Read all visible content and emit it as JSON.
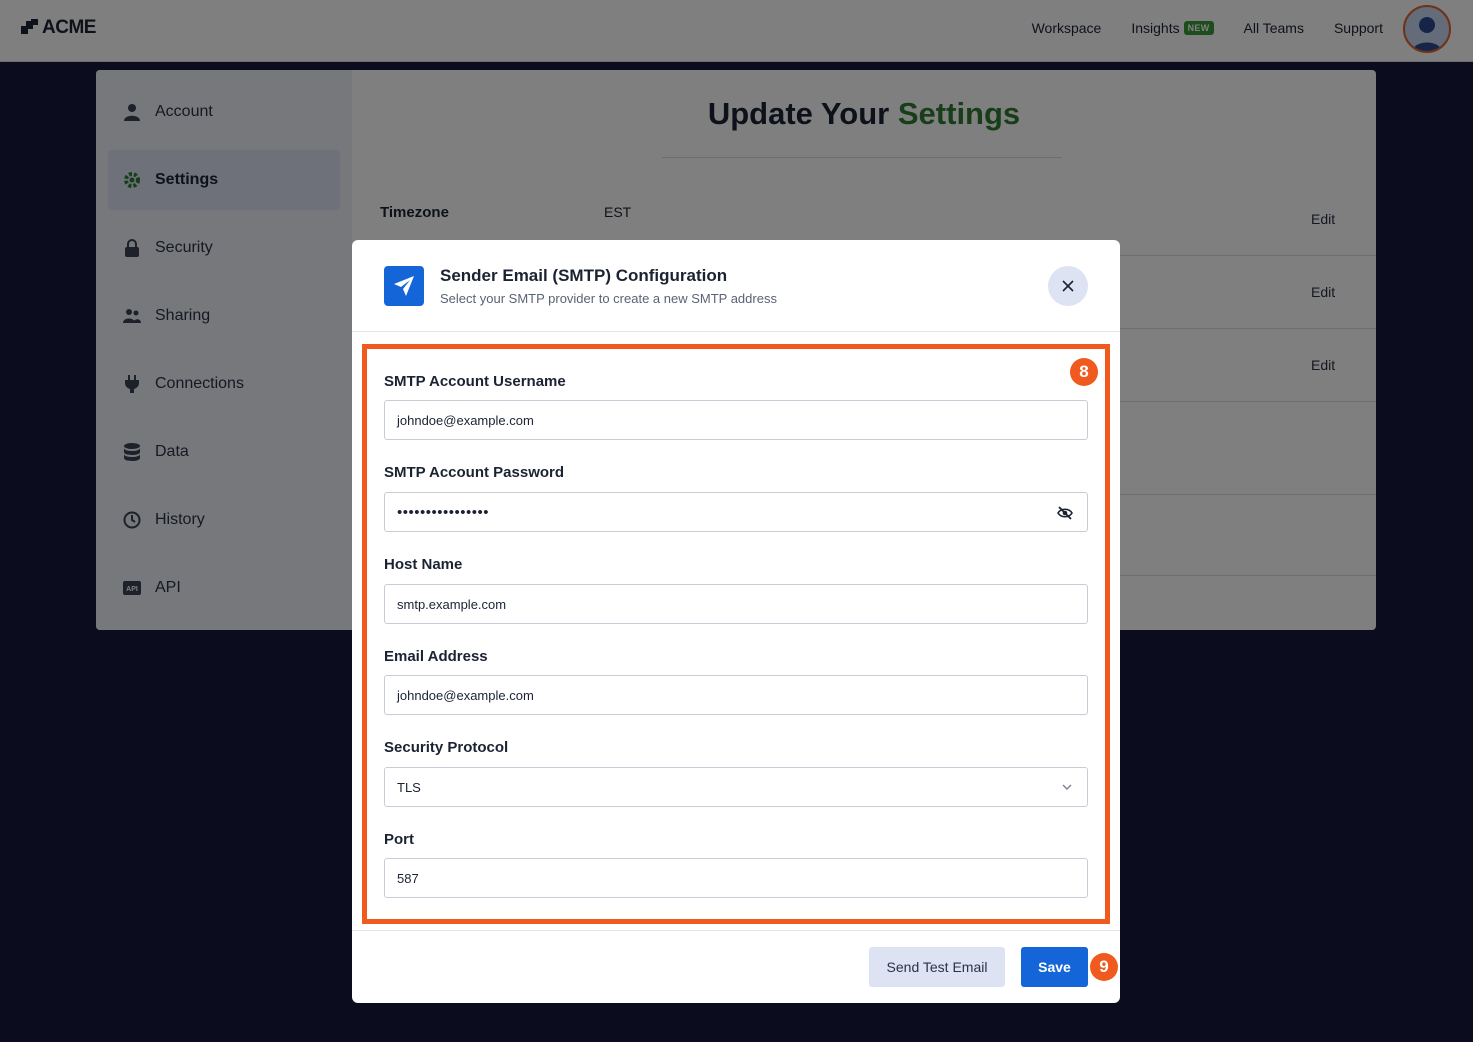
{
  "app": {
    "logo_text": "ACME"
  },
  "nav": {
    "items": [
      {
        "label": "Workspace"
      },
      {
        "label": "Insights",
        "badge": "NEW"
      },
      {
        "label": "All Teams"
      },
      {
        "label": "Support"
      }
    ]
  },
  "sidebar": {
    "items": [
      {
        "label": "Account",
        "icon": "user-icon"
      },
      {
        "label": "Settings",
        "icon": "gear-icon",
        "active": true
      },
      {
        "label": "Security",
        "icon": "lock-icon"
      },
      {
        "label": "Sharing",
        "icon": "users-icon"
      },
      {
        "label": "Connections",
        "icon": "plug-icon"
      },
      {
        "label": "Data",
        "icon": "database-icon"
      },
      {
        "label": "History",
        "icon": "history-icon"
      },
      {
        "label": "API",
        "icon": "api-icon"
      }
    ]
  },
  "main": {
    "title_prefix": "Update Your",
    "title_accent": "Settings",
    "timezone_label": "Timezone",
    "timezone_value": "EST",
    "edit_label": "Edit"
  },
  "modal": {
    "title": "Sender Email (SMTP) Configuration",
    "subtitle": "Select your SMTP provider to create a new SMTP address",
    "step_fields": "8",
    "step_save": "9",
    "fields": {
      "username": {
        "label": "SMTP Account Username",
        "value": "johndoe@example.com"
      },
      "password": {
        "label": "SMTP Account Password",
        "value": "••••••••••••••••"
      },
      "host": {
        "label": "Host Name",
        "value": "smtp.example.com"
      },
      "email": {
        "label": "Email Address",
        "value": "johndoe@example.com"
      },
      "protocol": {
        "label": "Security Protocol",
        "value": "TLS"
      },
      "port": {
        "label": "Port",
        "value": "587"
      }
    },
    "send_test_label": "Send Test Email",
    "save_label": "Save"
  },
  "colors": {
    "accent_green": "#2e7d32",
    "primary_blue": "#1466d8",
    "highlight_orange": "#f05a1e",
    "badge_green": "#3b9a3a"
  }
}
